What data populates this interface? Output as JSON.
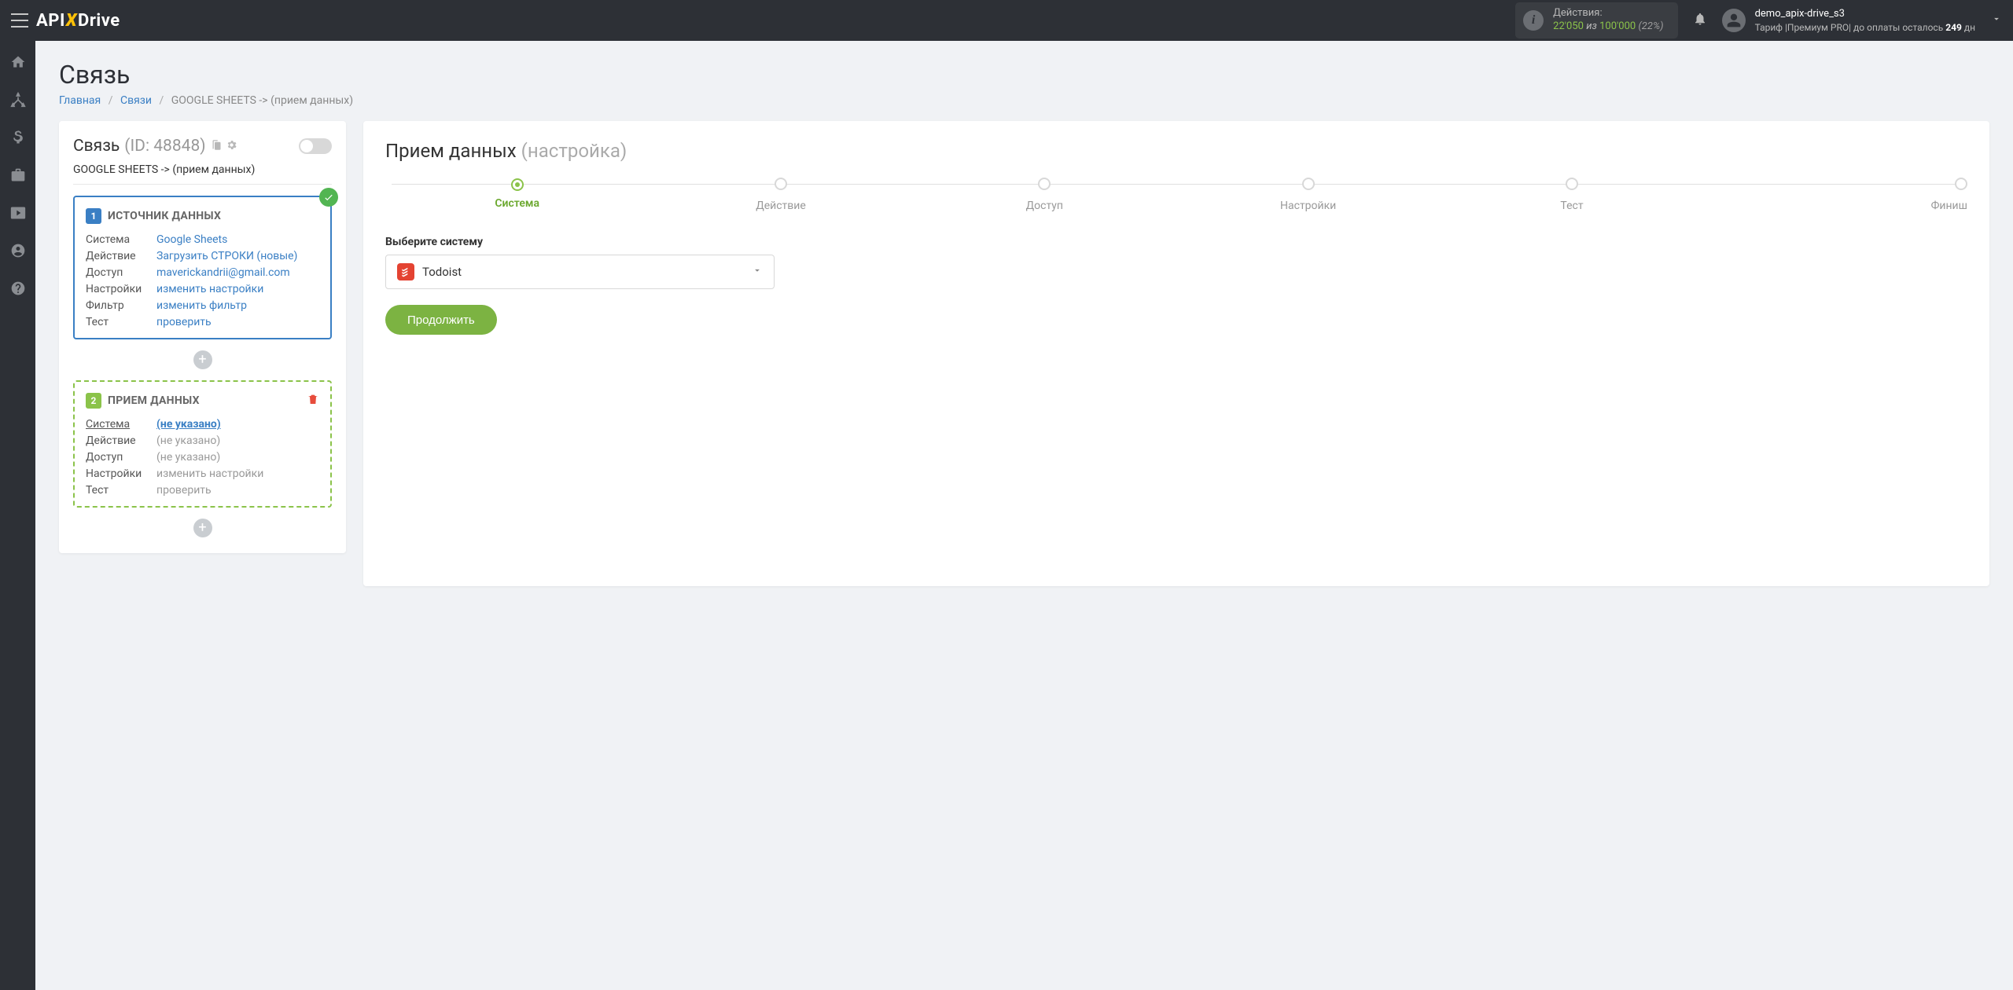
{
  "logo": {
    "pre": "API",
    "x": "X",
    "post": "Drive"
  },
  "header": {
    "actions_label": "Действия:",
    "actions_used": "22'050",
    "actions_iz": "из",
    "actions_total": "100'000",
    "actions_pct": "(22%)",
    "user_name": "demo_apix-drive_s3",
    "tariff_pre": "Тариф |Премиум PRO|  до оплаты осталось ",
    "tariff_days": "249",
    "tariff_post": " дн"
  },
  "page": {
    "title": "Связь",
    "crumb_home": "Главная",
    "crumb_links": "Связи",
    "crumb_current": "GOOGLE SHEETS -> (прием данных)"
  },
  "left": {
    "title": "Связь",
    "id": "(ID: 48848)",
    "subtitle": "GOOGLE SHEETS -> (прием данных)",
    "src": {
      "num": "1",
      "title": "ИСТОЧНИК ДАННЫХ",
      "rows": {
        "system_k": "Система",
        "system_v": "Google Sheets",
        "action_k": "Действие",
        "action_v": "Загрузить СТРОКИ (новые)",
        "access_k": "Доступ",
        "access_v": "maverickandrii@gmail.com",
        "settings_k": "Настройки",
        "settings_v": "изменить настройки",
        "filter_k": "Фильтр",
        "filter_v": "изменить фильтр",
        "test_k": "Тест",
        "test_v": "проверить"
      }
    },
    "dst": {
      "num": "2",
      "title": "ПРИЕМ ДАННЫХ",
      "rows": {
        "system_k": "Система",
        "system_v": "(не указано)",
        "action_k": "Действие",
        "action_v": "(не указано)",
        "access_k": "Доступ",
        "access_v": "(не указано)",
        "settings_k": "Настройки",
        "settings_v": "изменить настройки",
        "test_k": "Тест",
        "test_v": "проверить"
      }
    }
  },
  "right": {
    "title_main": "Прием данных",
    "title_sub": "(настройка)",
    "steps": [
      "Система",
      "Действие",
      "Доступ",
      "Настройки",
      "Тест",
      "Финиш"
    ],
    "field_label": "Выберите систему",
    "select_value": "Todoist",
    "continue": "Продолжить"
  }
}
